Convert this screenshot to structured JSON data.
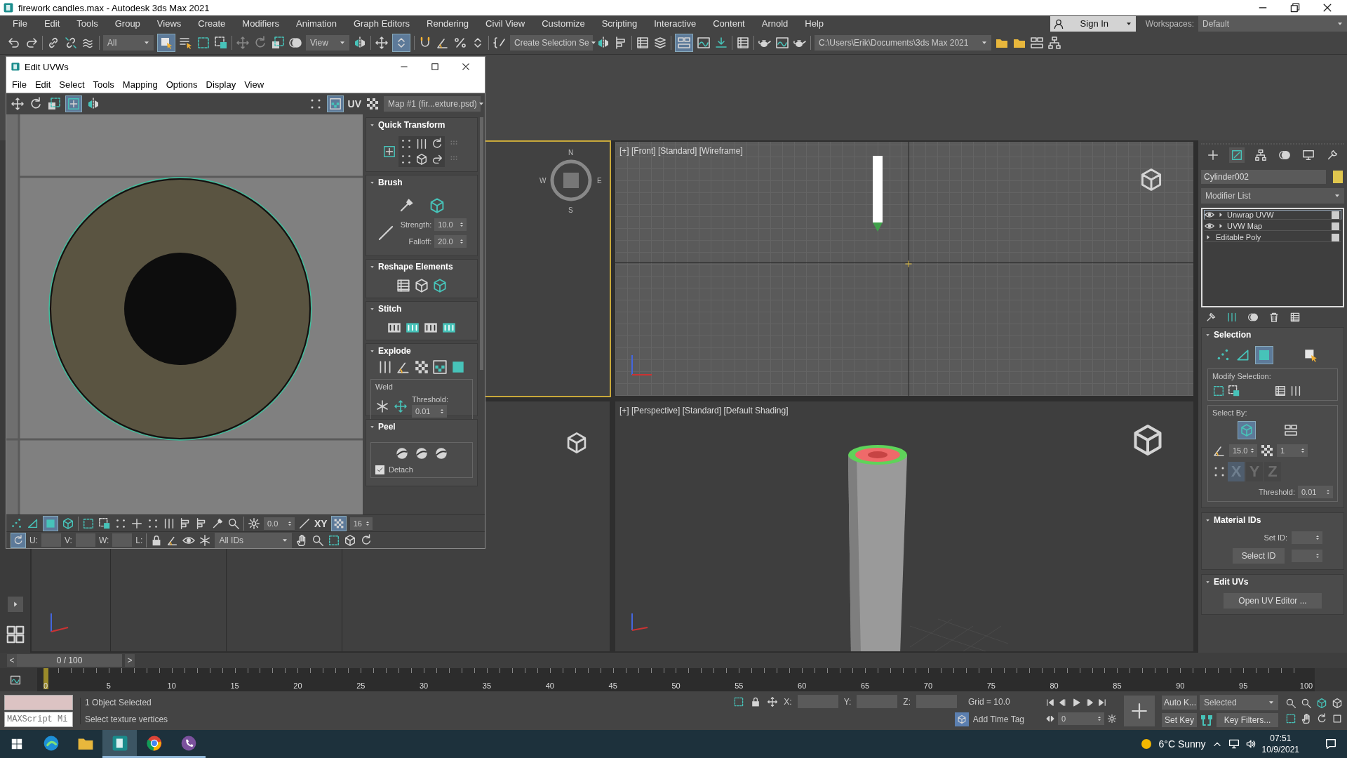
{
  "title_bar": {
    "title": "firework candles.max - Autodesk 3ds Max 2021"
  },
  "menu_bar": {
    "items": [
      "File",
      "Edit",
      "Tools",
      "Group",
      "Views",
      "Create",
      "Modifiers",
      "Animation",
      "Graph Editors",
      "Rendering",
      "Civil View",
      "Customize",
      "Scripting",
      "Interactive",
      "Content",
      "Arnold",
      "Help"
    ],
    "sign_in": "Sign In",
    "workspaces_label": "Workspaces:",
    "workspace": "Default"
  },
  "main_toolbar": {
    "filter": "All",
    "reference": "View",
    "selection_set": "Create Selection Se",
    "project_path": "C:\\Users\\Erik\\Documents\\3ds Max 2021"
  },
  "uv_editor": {
    "title": "Edit UVWs",
    "menu": [
      "File",
      "Edit",
      "Select",
      "Tools",
      "Mapping",
      "Options",
      "Display",
      "View"
    ],
    "uv_label": "UV",
    "map": "Map #1 (fir...exture.psd)",
    "rollouts": [
      {
        "kind": "quick",
        "title": "Quick Transform"
      },
      {
        "kind": "brush",
        "title": "Brush",
        "fields": [
          {
            "label": "Strength:",
            "value": "10.0"
          },
          {
            "label": "Falloff:",
            "value": "20.0"
          }
        ]
      },
      {
        "kind": "reshape",
        "title": "Reshape Elements"
      },
      {
        "kind": "stitch",
        "title": "Stitch"
      },
      {
        "kind": "explode",
        "title": "Explode",
        "weld": "Weld",
        "threshold_label": "Threshold:",
        "threshold": "0.01"
      },
      {
        "kind": "peel",
        "title": "Peel",
        "detach": {
          "label": "Detach",
          "checked": true
        }
      }
    ],
    "bottom": {
      "angle": "0.0",
      "axis": "XY",
      "count": "16",
      "u": "U:",
      "v": "V:",
      "w": "W:",
      "l": "L:",
      "ids": "All IDs"
    }
  },
  "viewports": [
    {
      "kind": "top",
      "active": true,
      "compass": [
        "N",
        "W",
        "E",
        "S"
      ]
    },
    {
      "kind": "front",
      "active": false,
      "label": "[+] [Front] [Standard] [Wireframe]"
    },
    {
      "kind": "left",
      "active": false
    },
    {
      "kind": "perspective",
      "active": false,
      "label": "[+] [Perspective] [Standard] [Default Shading]"
    }
  ],
  "command_panel": {
    "object_name": "Cylinder002",
    "modifier_list": "Modifier List",
    "stack": [
      {
        "label": "Unwrap UVW",
        "eye": true,
        "selected": true
      },
      {
        "label": "UVW Map",
        "eye": true,
        "selected": false
      },
      {
        "label": "Editable Poly",
        "eye": false,
        "selected": false
      }
    ],
    "selection": {
      "title": "Selection",
      "modify_label": "Modify Selection:",
      "select_by_label": "Select By:",
      "angle": "15.0",
      "count": "1",
      "axes": [
        {
          "label": "X",
          "selected": true
        },
        {
          "label": "Y",
          "selected": false
        },
        {
          "label": "Z",
          "selected": false
        }
      ],
      "threshold_label": "Threshold:",
      "threshold": "0.01"
    },
    "material_ids": {
      "title": "Material IDs",
      "set_id_label": "Set ID:",
      "select_id": "Select ID"
    },
    "edit_uvs": {
      "title": "Edit UVs",
      "open_editor": "Open UV Editor ..."
    }
  },
  "time_slider": {
    "prev": "<",
    "position": "0 / 100",
    "next": ">",
    "level": 0
  },
  "track_bar": {
    "ticks": [
      "0",
      "5",
      "10",
      "15",
      "20",
      "25",
      "30",
      "35",
      "40",
      "45",
      "50",
      "55",
      "60",
      "65",
      "70",
      "75",
      "80",
      "85",
      "90",
      "95",
      "100"
    ]
  },
  "status": {
    "maxscript_placeholder": "MAXScript Mi",
    "message": "1 Object Selected",
    "prompt": "Select texture vertices",
    "x": "X:",
    "y": "Y:",
    "z": "Z:",
    "grid": "Grid = 10.0",
    "time_tag": "Add Time Tag",
    "frame": "0",
    "auto_key": "Auto K...",
    "key_mode": "Selected",
    "set_key": "Set Key",
    "key_filters": "Key Filters..."
  },
  "taskbar": {
    "apps": [
      {
        "kind": "edge",
        "selected": false,
        "running": false
      },
      {
        "kind": "explorer",
        "selected": false,
        "running": false
      },
      {
        "kind": "max",
        "selected": true,
        "running": true
      },
      {
        "kind": "chrome",
        "selected": false,
        "running": true
      },
      {
        "kind": "viber",
        "selected": false,
        "running": true
      }
    ],
    "weather": "6°C Sunny",
    "time": "07:51",
    "date": "10/9/2021"
  }
}
